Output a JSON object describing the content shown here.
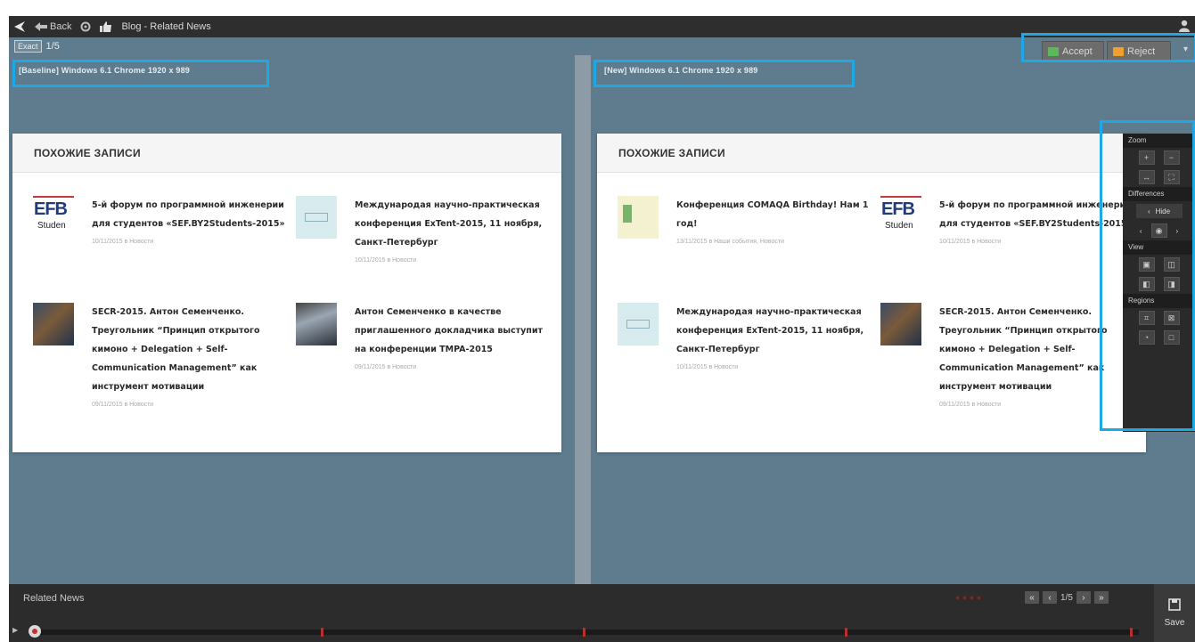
{
  "topbar": {
    "back_label": "Back",
    "title": "Blog - Related News"
  },
  "subbar": {
    "mode": "Exact",
    "counter": "1/5"
  },
  "actions": {
    "accept": "Accept",
    "reject": "Reject"
  },
  "baseline": {
    "label": "[Baseline]   Windows 6.1   Chrome   1920 x 989",
    "heading": "ПОХОЖИЕ ЗАПИСИ",
    "posts": [
      {
        "title": "5-й форум по программной инженерии для студентов «SEF.BY2Students-2015»",
        "meta": "10/11/2015 в Новости",
        "thumb": "efb-logo"
      },
      {
        "title": "Международая научно-практическая конференция ExTent-2015, 11 ноября, Санкт-Петербург",
        "meta": "10/11/2015 в Новости",
        "thumb": "light-blue"
      },
      {
        "title": "SECR-2015. Антон Семенченко. Треугольник “Принцип открытого кимоно + Delegation + Self-Communication Management” как инструмент мотивации",
        "meta": "09/11/2015 в Новости",
        "thumb": "photo"
      },
      {
        "title": "Антон Семенченко в качестве приглашенного докладчика выступит на конференции TMPA-2015",
        "meta": "09/11/2015 в Новости",
        "thumb": "photo2"
      }
    ]
  },
  "new": {
    "label": "[New]   Windows 6.1   Chrome   1920 x 989",
    "heading": "ПОХОЖИЕ ЗАПИСИ",
    "posts": [
      {
        "title": "Конференция COMAQA Birthday! Нам 1 год!",
        "meta": "13/11/2015 в Наши события, Новости",
        "thumb": "yellow"
      },
      {
        "title": "5-й форум по программной инженерии для студентов «SEF.BY2Students-2015»",
        "meta": "10/11/2015 в Новости",
        "thumb": "efb-logo"
      },
      {
        "title": "Международая научно-практическая конференция ExTent-2015, 11 ноября, Санкт-Петербург",
        "meta": "10/11/2015 в Новости",
        "thumb": "light-blue"
      },
      {
        "title": "SECR-2015. Антон Семенченко. Треугольник “Принцип открытого кимоно + Delegation + Self-Communication Management” как инструмент мотивации",
        "meta": "09/11/2015 в Новости",
        "thumb": "photo"
      }
    ]
  },
  "efb": {
    "big": "EFB",
    "small": "Studen"
  },
  "tools": {
    "zoom": "Zoom",
    "differences": "Differences",
    "hide": "Hide",
    "view": "View",
    "regions": "Regions"
  },
  "bottom": {
    "test_name": "Related News",
    "page": "1/5",
    "save": "Save"
  },
  "colors": {
    "accent_box": "#1ea8e6",
    "background": "#5f7c8e",
    "accept": "#5cb85c",
    "reject": "#f0a030",
    "timeline_mark": "#b53030"
  }
}
